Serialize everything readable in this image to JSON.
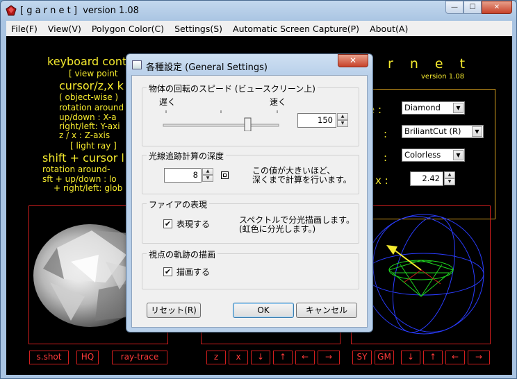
{
  "window": {
    "title": "[ g a r n e t ]  version 1.08",
    "minimize": "—",
    "maximize": "☐",
    "close": "✕"
  },
  "menu": [
    "File(F)",
    "View(V)",
    "Polygon Color(C)",
    "Settings(S)",
    "Automatic Screen Capture(P)",
    "About(A)"
  ],
  "help": {
    "heading": "keyboard cont",
    "view_point": "[ view point",
    "cursor_line": "cursor/z,x k",
    "object_wise": "( object-wise )",
    "rotation_around": "rotation around",
    "up_down": "up/down   : X-a",
    "right_left": "right/left: Y-axi",
    "zx": "z / x     : Z-axis",
    "light_ray": "[ light ray ]",
    "shift_cursor": "shift + cursor l",
    "rotation_around2": "rotation around-",
    "sft_up_down": "sft + up/down   : lo",
    "sft_right_left": "+ right/left: glob"
  },
  "brand": {
    "name": "r n e t",
    "version": "version 1.08"
  },
  "info": {
    "labels": [
      "e :",
      ":",
      ":",
      "x :"
    ],
    "shape": "Diamond",
    "cut": "BriliantCut (R)",
    "color": "Colorless",
    "index_value": "2.42"
  },
  "bottom_buttons": {
    "left": [
      "s.shot",
      "HQ",
      "ray-trace"
    ],
    "middle": [
      "z",
      "x",
      "↓",
      "↑",
      "←",
      "→"
    ],
    "right": [
      "SY",
      "GM",
      "↓",
      "↑",
      "←",
      "→"
    ]
  },
  "dialog": {
    "title": "各種設定 (General Settings)",
    "close": "✕",
    "speed": {
      "title": "物体の回転のスピード (ビュースクリーン上)",
      "slow": "遅く",
      "fast": "速く",
      "value": "150"
    },
    "depth": {
      "title": "光線追跡計算の深度",
      "value": "8",
      "note_line1": "この値が大きいほど、",
      "note_line2": "深くまで計算を行います。"
    },
    "fire": {
      "title": "ファイアの表現",
      "check_label": "表現する",
      "checked": "✔",
      "note_line1": "スペクトルで分光描画します。",
      "note_line2": "(虹色に分光します。)"
    },
    "trail": {
      "title": "視点の軌跡の描画",
      "check_label": "描画する",
      "checked": "✔"
    },
    "reset": "リセット(R)",
    "ok": "OK",
    "cancel": "キャンセル"
  }
}
